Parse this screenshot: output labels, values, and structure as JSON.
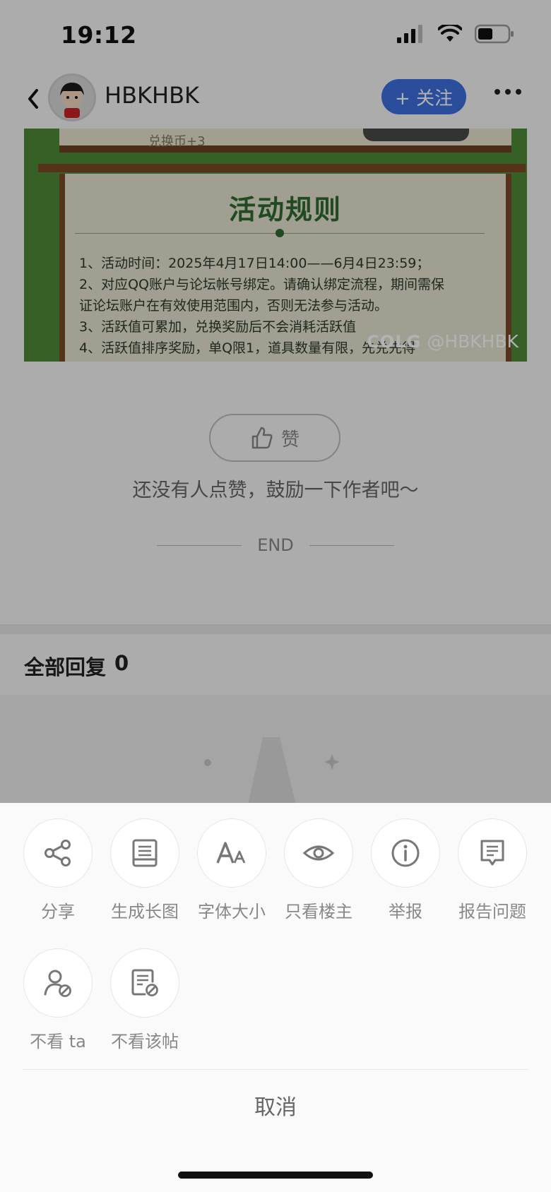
{
  "status_bar": {
    "time": "19:12"
  },
  "header": {
    "username": "HBKHBK",
    "follow_label": "+ 关注"
  },
  "post_image": {
    "top_text": "兑换币+3",
    "title": "活动规则",
    "lines": [
      "1、活动时间：2025年4月17日14:00——6月4日23:59；",
      "2、对应QQ账户与论坛帐号绑定。请确认绑定流程，期间需保",
      "证论坛账户在有效使用范围内，否则无法参与活动。",
      "3、活跃值可累加，兑换奖励后不会消耗活跃值",
      "4、活跃值排序奖励，单Q限1，道具数量有限，先兑先得"
    ],
    "watermark_logo": "COLG",
    "watermark_user": "@HBKHBK"
  },
  "like": {
    "label": "赞",
    "hint": "还没有人点赞，鼓励一下作者吧～"
  },
  "end_text": "END",
  "replies": {
    "title": "全部回复",
    "count": "0"
  },
  "sheet": {
    "row1": [
      {
        "icon": "share-icon",
        "label": "分享"
      },
      {
        "icon": "long-image-icon",
        "label": "生成长图"
      },
      {
        "icon": "font-size-icon",
        "label": "字体大小"
      },
      {
        "icon": "eye-icon",
        "label": "只看楼主"
      },
      {
        "icon": "info-icon",
        "label": "举报"
      },
      {
        "icon": "report-issue-icon",
        "label": "报告问题"
      }
    ],
    "row2": [
      {
        "icon": "block-user-icon",
        "label": "不看 ta"
      },
      {
        "icon": "block-post-icon",
        "label": "不看该帖"
      }
    ],
    "cancel_label": "取消"
  }
}
